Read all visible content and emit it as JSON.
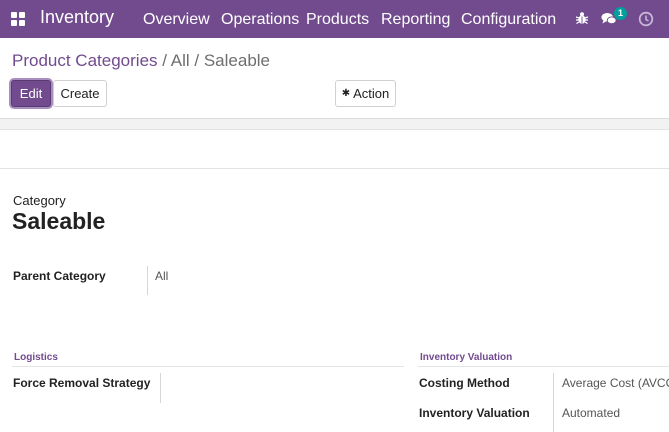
{
  "navbar": {
    "brand": "Inventory",
    "menu": [
      "Overview",
      "Operations",
      "Products",
      "Reporting",
      "Configuration"
    ],
    "messages_count": "1",
    "bg_color": "#714b8e"
  },
  "breadcrumb": {
    "root": "Product Categories",
    "sep1": " / ",
    "middle": "All",
    "sep2": " / ",
    "current": "Saleable"
  },
  "toolbar": {
    "edit_label": "Edit",
    "create_label": "Create",
    "action_label": "Action"
  },
  "form": {
    "category_label": "Category",
    "name": "Saleable",
    "parent_category_label": "Parent Category",
    "parent_category_value": "All",
    "logistics": {
      "title": "Logistics",
      "force_removal_label": "Force Removal Strategy",
      "force_removal_value": ""
    },
    "inventory_valuation": {
      "title": "Inventory Valuation",
      "costing_method_label": "Costing Method",
      "costing_method_value": "Average Cost (AVCO)",
      "valuation_label": "Inventory Valuation",
      "valuation_value": "Automated"
    }
  }
}
